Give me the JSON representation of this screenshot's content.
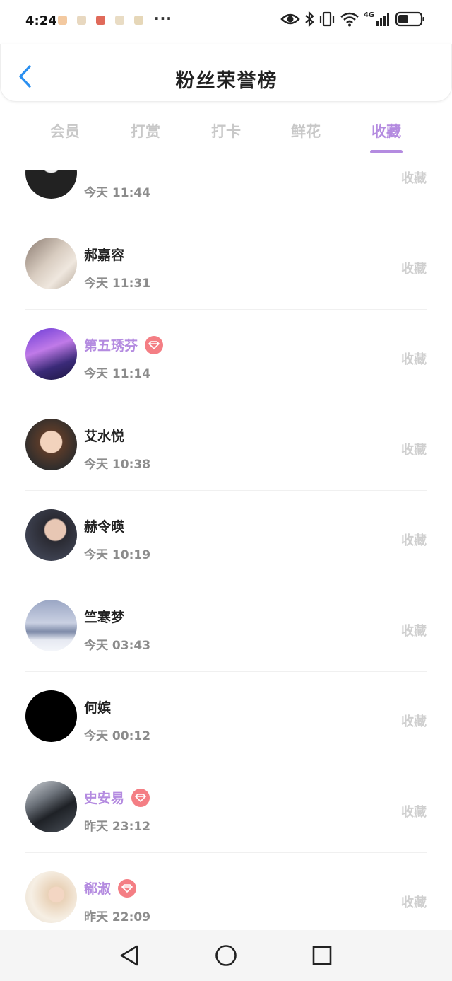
{
  "status_bar": {
    "time": "4:24",
    "more": "···",
    "network": "4G",
    "icons": [
      "eye-icon",
      "bluetooth-icon",
      "vibrate-icon",
      "wifi-icon",
      "signal-icon",
      "battery-icon"
    ]
  },
  "header": {
    "title": "粉丝荣誉榜"
  },
  "tabs": [
    "会员",
    "打赏",
    "打卡",
    "鲜花",
    "收藏"
  ],
  "active_tab": "收藏",
  "colors": {
    "accent": "#b48be0",
    "vip_badge": "#f47e84",
    "muted": "#cfcfcf"
  },
  "rows": [
    {
      "name": "",
      "time": "今天 11:44",
      "action": "收藏",
      "vip": false
    },
    {
      "name": "郝嘉容",
      "time": "今天 11:31",
      "action": "收藏",
      "vip": false
    },
    {
      "name": "第五琇芬",
      "time": "今天 11:14",
      "action": "收藏",
      "vip": true
    },
    {
      "name": "艾水悦",
      "time": "今天 10:38",
      "action": "收藏",
      "vip": false
    },
    {
      "name": "赫令暎",
      "time": "今天 10:19",
      "action": "收藏",
      "vip": false
    },
    {
      "name": "竺寒梦",
      "time": "今天 03:43",
      "action": "收藏",
      "vip": false
    },
    {
      "name": "何嫔",
      "time": "今天 00:12",
      "action": "收藏",
      "vip": false
    },
    {
      "name": "史安易",
      "time": "昨天 23:12",
      "action": "收藏",
      "vip": true
    },
    {
      "name": "郗淑",
      "time": "昨天 22:09",
      "action": "收藏",
      "vip": true
    }
  ]
}
